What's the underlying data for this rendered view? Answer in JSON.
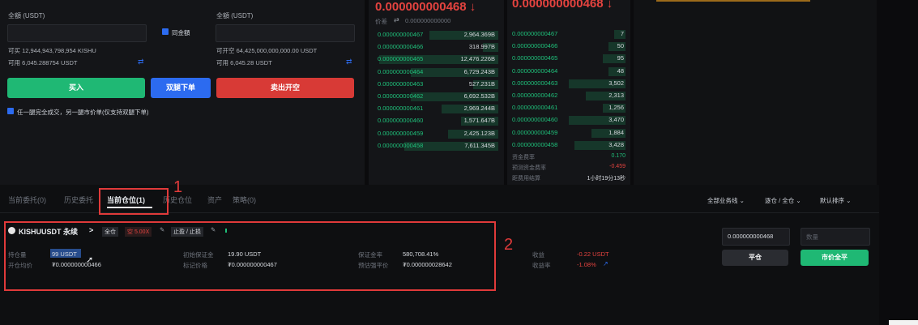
{
  "order_form": {
    "left": {
      "amount_label": "全額 (USDT)",
      "available_label": "可买 12,944,943,798,954 KISHU",
      "balance_label": "可用 6,045.288754 USDT"
    },
    "right": {
      "amount_label": "全額 (USDT)",
      "available_label": "可开空 64,425,000,000,000.00 USDT",
      "balance_label": "可用 6,045.28 USDT"
    },
    "sync_checkbox_label": "同金額",
    "buy_button": "买入",
    "dual_button": "双腿下单",
    "sell_button": "卖出开空",
    "note_checkbox_label": "任一腿完全成交，另一腿市价单(仅支持双腿下单)"
  },
  "orderbook_left": {
    "price_big": "0.000000000468 ↓",
    "sub_label": "价差",
    "sub_value": "0.000000000000",
    "rows": [
      {
        "price": "0.000000000467",
        "qty": "2,964.369B",
        "depth": 0.55
      },
      {
        "price": "0.000000000466",
        "qty": "318.997B",
        "depth": 0.12
      },
      {
        "price": "0.000000000465",
        "qty": "12,476.226B",
        "depth": 0.95
      },
      {
        "price": "0.000000000464",
        "qty": "6,729.243B",
        "depth": 0.7
      },
      {
        "price": "0.000000000463",
        "qty": "527.231B",
        "depth": 0.2
      },
      {
        "price": "0.000000000462",
        "qty": "6,692.532B",
        "depth": 0.7
      },
      {
        "price": "0.000000000461",
        "qty": "2,969.244B",
        "depth": 0.45
      },
      {
        "price": "0.000000000460",
        "qty": "1,571.647B",
        "depth": 0.3
      },
      {
        "price": "0.000000000459",
        "qty": "2,425.123B",
        "depth": 0.4
      },
      {
        "price": "0.000000000458",
        "qty": "7,611.345B",
        "depth": 0.75
      }
    ]
  },
  "orderbook_right": {
    "price_big": "0.000000000468 ↓",
    "rows": [
      {
        "price": "0.000000000467",
        "qty": "7",
        "depth": 0.1
      },
      {
        "price": "0.000000000466",
        "qty": "50",
        "depth": 0.15
      },
      {
        "price": "0.000000000465",
        "qty": "95",
        "depth": 0.2
      },
      {
        "price": "0.000000000464",
        "qty": "48",
        "depth": 0.15
      },
      {
        "price": "0.000000000463",
        "qty": "3,502",
        "depth": 0.5
      },
      {
        "price": "0.000000000462",
        "qty": "2,313",
        "depth": 0.35
      },
      {
        "price": "0.000000000461",
        "qty": "1,256",
        "depth": 0.2
      },
      {
        "price": "0.000000000460",
        "qty": "3,470",
        "depth": 0.5
      },
      {
        "price": "0.000000000459",
        "qty": "1,884",
        "depth": 0.3
      },
      {
        "price": "0.000000000458",
        "qty": "3,428",
        "depth": 0.45
      }
    ],
    "stats": [
      {
        "label": "资金费率",
        "value": "0.170",
        "color": "#1fc07a"
      },
      {
        "label": "预测资金费率",
        "value": "-0.459",
        "color": "#e4433f"
      },
      {
        "label": "距费用结算",
        "value": "1小时19分13秒",
        "color": "#d6d9de"
      }
    ]
  },
  "tabs": [
    {
      "label": "当前委托(0)",
      "active": false
    },
    {
      "label": "历史委托",
      "active": false
    },
    {
      "label": "当前仓位(1)",
      "active": true
    },
    {
      "label": "历史仓位",
      "active": false
    },
    {
      "label": "资产",
      "active": false
    },
    {
      "label": "策略(0)",
      "active": false
    }
  ],
  "filters": [
    "全部业务线 ⌄",
    "逐仓 / 全仓 ⌄",
    "默认排序 ⌄"
  ],
  "annotations": {
    "one": "1",
    "two": "2"
  },
  "position": {
    "symbol": "KISHUUSDT 永续",
    "chevron": ">",
    "tag_mode": "全仓",
    "tag_side": "空 5.00X",
    "tag_tp": "止盈 / 止损",
    "fields": [
      {
        "label": "持仓量",
        "value": "99 USDT",
        "color": "#d6d9de"
      },
      {
        "label": "开仓均价",
        "value": "₮0.000000000466",
        "color": "#d6d9de"
      },
      {
        "label": "初始保证金",
        "value": "19.90 USDT",
        "color": "#d6d9de"
      },
      {
        "label": "标记价格",
        "value": "₮0.000000000467",
        "color": "#d6d9de"
      },
      {
        "label": "保证金率",
        "value": "580,708.41%",
        "color": "#d6d9de"
      },
      {
        "label": "预估强平价",
        "value": "₮0.000000028642",
        "color": "#d6d9de"
      },
      {
        "label": "收益",
        "value": "-0.22 USDT",
        "color": "#e4433f"
      },
      {
        "label": "收益率",
        "value": "-1.08%",
        "color": "#e4433f"
      }
    ],
    "close_price_value": "0.000000000468",
    "close_qty_placeholder": "数量",
    "close_button": "平仓",
    "market_close_button": "市价全平"
  },
  "colors": {
    "green": "#1fc07a",
    "red": "#e4433f",
    "blue": "#2c6bf0",
    "highlight": "#e03a3a"
  }
}
